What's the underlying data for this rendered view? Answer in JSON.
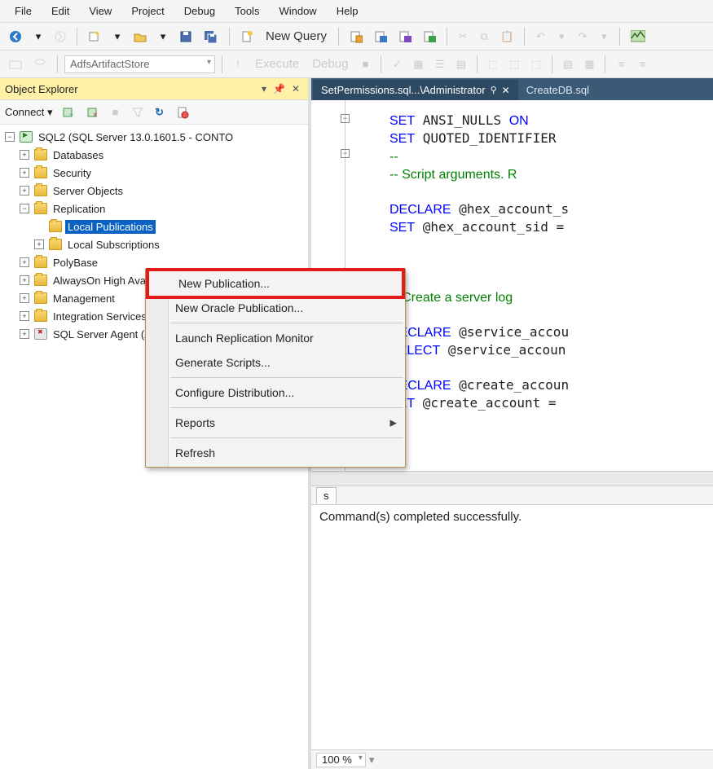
{
  "menu": {
    "file": "File",
    "edit": "Edit",
    "view": "View",
    "project": "Project",
    "debug": "Debug",
    "tools": "Tools",
    "window": "Window",
    "help": "Help"
  },
  "toolbar1": {
    "new_query": "New Query"
  },
  "toolbar2": {
    "db_combo": "AdfsArtifactStore",
    "execute": "Execute",
    "debug": "Debug"
  },
  "panel": {
    "title": "Object Explorer",
    "connect_label": "Connect",
    "root": "SQL2 (SQL Server 13.0.1601.5 - CONTO",
    "nodes": {
      "databases": "Databases",
      "security": "Security",
      "server_objects": "Server Objects",
      "replication": "Replication",
      "local_publications": "Local Publications",
      "local_subscriptions": "Local Subscriptions",
      "polybase": "PolyBase",
      "alwayson": "AlwaysOn High Availability",
      "management": "Management",
      "integration": "Integration Services Catalogs",
      "sqlagent": "SQL Server Agent (Agent XPs disabled)"
    }
  },
  "context_menu": {
    "new_publication": "New Publication...",
    "new_oracle_publication": "New Oracle Publication...",
    "launch_monitor": "Launch Replication Monitor",
    "generate_scripts": "Generate Scripts...",
    "configure_distribution": "Configure Distribution...",
    "reports": "Reports",
    "refresh": "Refresh"
  },
  "tabs": {
    "active": "SetPermissions.sql...\\Administrator",
    "inactive": "CreateDB.sql"
  },
  "code_lines": [
    "SET ANSI_NULLS ON",
    "SET QUOTED_IDENTIFIER",
    "--",
    "-- Script arguments. R",
    "",
    "DECLARE @hex_account_s",
    "SET @hex_account_sid =",
    "",
    "",
    "--",
    "-- Create a server log",
    "",
    "DECLARE @service_accou",
    "SELECT @service_accoun",
    "",
    "DECLARE @create_accoun",
    "SET @create_account = "
  ],
  "output": {
    "tab_label": "s",
    "completed_msg": "Command(s) completed successfully."
  },
  "zoom": {
    "value": "100 %"
  }
}
